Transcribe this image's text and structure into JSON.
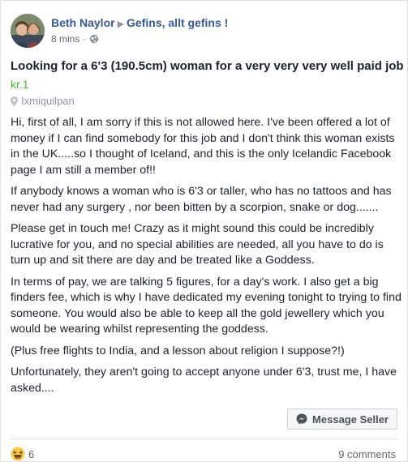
{
  "post": {
    "author": "Beth Naylor",
    "group": "Gefins, allt gefins !",
    "timestamp": "8 mins",
    "audience_icon": "globe-icon",
    "title": "Looking for a 6'3 (190.5cm) woman for a very very very well paid job",
    "price": "kr.1",
    "location": "Ixmiquilpan",
    "paragraphs": [
      "Hi, first of all, I am sorry if this is not allowed here. I've been offered a lot of money if I can find somebody for this job and I don't think this woman exists in the UK.....so I thought of Iceland, and this is the only Icelandic Facebook page I am still a member of!!",
      "If anybody knows a woman who is 6'3 or taller, who has no tattoos and has never had any surgery , nor been bitten by a scorpion, snake or dog.......",
      "Please get in touch me! Crazy as it might sound this could be incredibly lucrative for you, and no special abilities are needed, all you have to do is turn up and sit there are day and be treated like a Goddess.",
      "In terms of pay, we are talking 5 figures, for a day's work. I also get a big finders fee, which is why I have dedicated my evening tonight to trying to find someone. You would also be able to keep all the gold jewellery which you would be wearing whilst representing the goddess.",
      "(Plus free flights to India, and a lesson about religion I suppose?!)",
      "Unfortunately, they aren't going to accept anyone under 6'3, trust me, I have asked...."
    ]
  },
  "actions": {
    "message_seller": "Message Seller"
  },
  "footer": {
    "reaction_count": "6",
    "reaction_icon": "haha-emoji-icon",
    "comments": "9 comments"
  },
  "colors": {
    "link": "#365899",
    "price": "#42b72a",
    "muted": "#90949c"
  }
}
